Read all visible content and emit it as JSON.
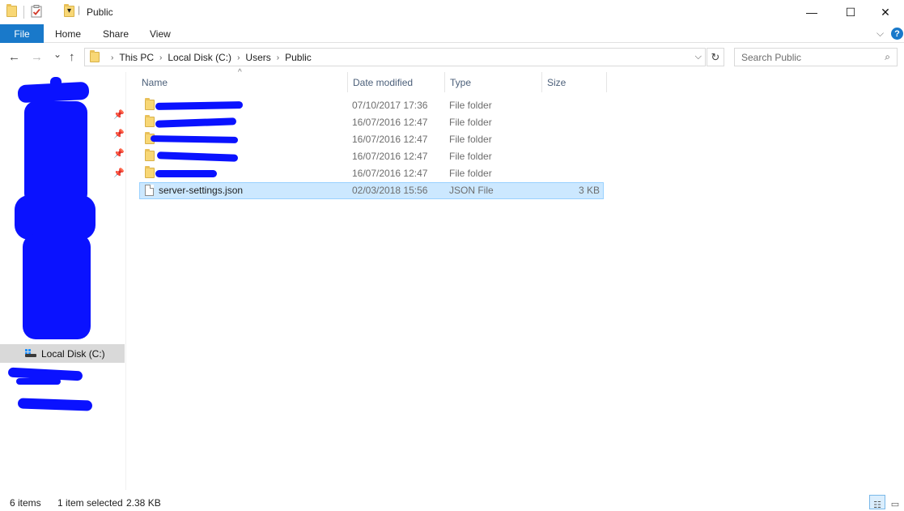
{
  "window": {
    "title": "Public",
    "minimize": "—",
    "maximize": "☐",
    "close": "✕"
  },
  "quick_access": {
    "dropdown": "▾",
    "separator": "|"
  },
  "ribbon": {
    "file": "File",
    "tabs": [
      "Home",
      "Share",
      "View"
    ],
    "expand": "⌵",
    "help": "?"
  },
  "nav": {
    "back": "←",
    "forward": "→",
    "recent": "⌄",
    "up": "↑"
  },
  "address": {
    "crumbs": [
      "This PC",
      "Local Disk (C:)",
      "Users",
      "Public"
    ],
    "chevron": "›",
    "dropdown": "⌵",
    "refresh": "↻"
  },
  "search": {
    "placeholder": "Search Public",
    "icon": "⌕"
  },
  "navpane": {
    "pin": "📌",
    "selected_item": "Local Disk (C:)"
  },
  "columns": {
    "name": "Name",
    "date": "Date modified",
    "type": "Type",
    "size": "Size",
    "sort_indicator": "^"
  },
  "rows": [
    {
      "name": "",
      "date": "07/10/2017 17:36",
      "type": "File folder",
      "size": ""
    },
    {
      "name": "",
      "date": "16/07/2016 12:47",
      "type": "File folder",
      "size": ""
    },
    {
      "name": "",
      "date": "16/07/2016 12:47",
      "type": "File folder",
      "size": ""
    },
    {
      "name": "",
      "date": "16/07/2016 12:47",
      "type": "File folder",
      "size": ""
    },
    {
      "name": "",
      "date": "16/07/2016 12:47",
      "type": "File folder",
      "size": ""
    },
    {
      "name": "server-settings.json",
      "date": "02/03/2018 15:56",
      "type": "JSON File",
      "size": "3 KB"
    }
  ],
  "status": {
    "count": "6 items",
    "selected": "1 item selected",
    "selected_size": "2.38 KB"
  },
  "views": {
    "details": "☷",
    "large_icons": "▭"
  },
  "colors": {
    "file_tab": "#1979ca",
    "selection_fill": "#cce8ff",
    "selection_border": "#99d1ff",
    "redaction": "#0a12ff"
  }
}
